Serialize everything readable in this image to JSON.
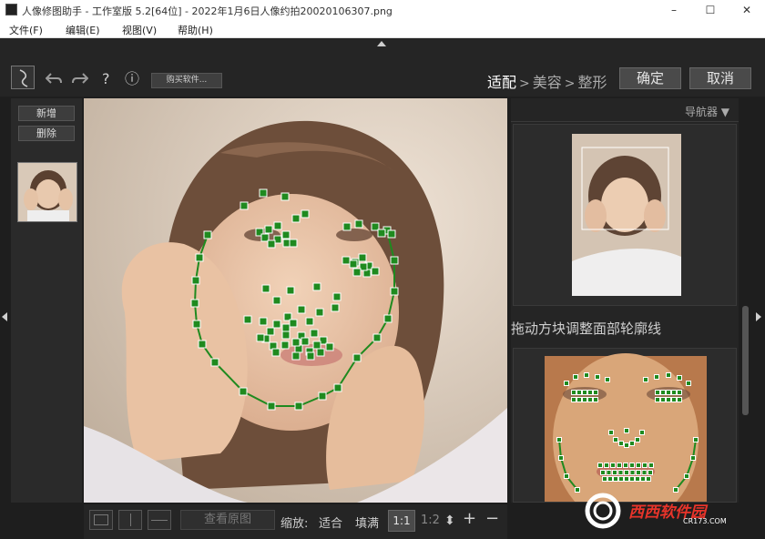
{
  "window": {
    "title": "人像修图助手 - 工作室版 5.2[64位] - 2022年1月6日人像约拍20020106307.png",
    "minimize_glyph": "–",
    "maximize_glyph": "☐",
    "close_glyph": "✕"
  },
  "menu": {
    "items": [
      "文件(F)",
      "编辑(E)",
      "视图(V)",
      "帮助(H)"
    ]
  },
  "toolbar": {
    "undo_icon": "undo-arrow-icon",
    "redo_icon": "redo-arrow-icon",
    "help_glyph": "?",
    "info_glyph": "ⓘ",
    "buy_label": "购买软件...",
    "steps": [
      "适配",
      "美容",
      "整形"
    ],
    "step_separator": ">",
    "active_step": "适配",
    "confirm_label": "确定",
    "cancel_label": "取消"
  },
  "left_panel": {
    "add_label": "新增",
    "delete_label": "删除"
  },
  "bottom_bar": {
    "view_original_label": "查看原图",
    "zoom_label": "缩放:",
    "fit_label": "适合",
    "fill_label": "填满",
    "zoom_1_1": "1:1",
    "zoom_1_2": "1:2",
    "plus_glyph": "+",
    "minus_glyph": "−",
    "stepper_glyph": "⬍"
  },
  "right_panel": {
    "navigator_label": "导航器 ▼",
    "hint_text": "拖动方块调整面部轮廓线"
  },
  "watermark": {
    "logo_text": "西西软件园",
    "url_text": "CR173.COM"
  },
  "colors": {
    "landmark_fill": "#1f8a1f",
    "landmark_stroke": "#ffffff",
    "background": "#1e1e1e",
    "watermark_red": "#e8342a"
  }
}
